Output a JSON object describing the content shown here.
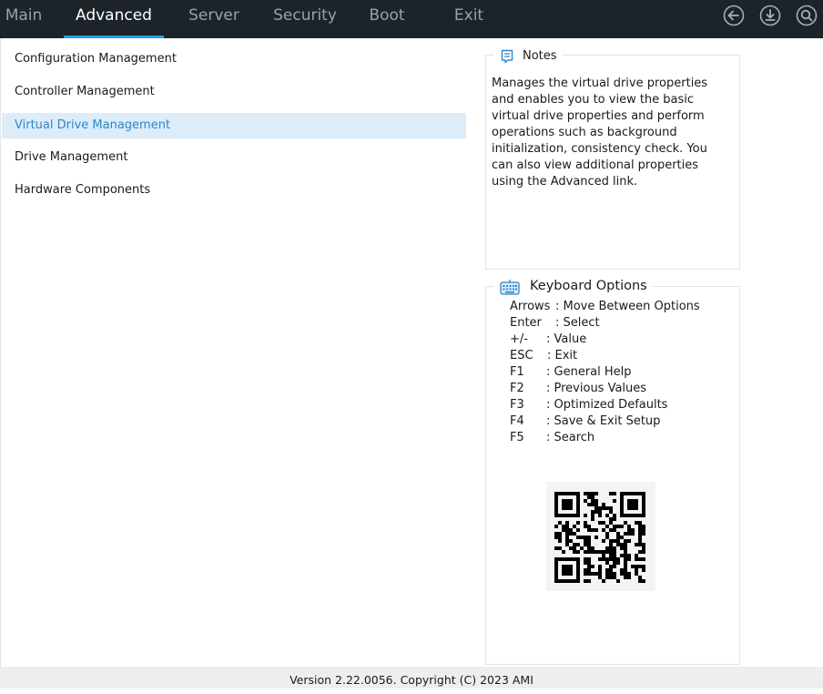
{
  "tabs": [
    {
      "label": "Main"
    },
    {
      "label": "Advanced"
    },
    {
      "label": "Server"
    },
    {
      "label": "Security"
    },
    {
      "label": "Boot"
    },
    {
      "label": "Exit"
    }
  ],
  "active_tab": "Advanced",
  "top_icons": [
    "back-arrow-icon",
    "save-download-icon",
    "search-icon"
  ],
  "menu": {
    "items": [
      {
        "label": "Configuration Management"
      },
      {
        "label": "Controller Management"
      },
      {
        "label": "Virtual Drive Management"
      },
      {
        "label": "Drive Management"
      },
      {
        "label": "Hardware Components"
      }
    ],
    "selected": "Virtual Drive Management"
  },
  "notes": {
    "title": "Notes",
    "text": "Manages the virtual drive properties and enables you to view the basic virtual drive properties and perform operations such as background initialization, consistency check. You can also view additional properties using the Advanced link."
  },
  "keyboard": {
    "title": "Keyboard Options",
    "options": [
      {
        "key": "Arrows",
        "desc": ": Move Between Options"
      },
      {
        "key": "Enter",
        "desc": ": Select"
      },
      {
        "key": "+/-",
        "desc": ": Value"
      },
      {
        "key": "ESC",
        "desc": ": Exit"
      },
      {
        "key": "F1",
        "desc": ": General Help"
      },
      {
        "key": "F2",
        "desc": ": Previous Values"
      },
      {
        "key": "F3",
        "desc": ": Optimized Defaults"
      },
      {
        "key": "F4",
        "desc": ": Save & Exit Setup"
      },
      {
        "key": "F5",
        "desc": ": Search"
      }
    ]
  },
  "footer": {
    "text": "Version 2.22.0056. Copyright (C) 2023 AMI"
  },
  "colors": {
    "topbar": "#1c2329",
    "accent": "#1ea0e8",
    "selected_bg": "#dcecf8",
    "selected_text": "#2b87c9",
    "inactive_tab": "#9aa1a7"
  }
}
